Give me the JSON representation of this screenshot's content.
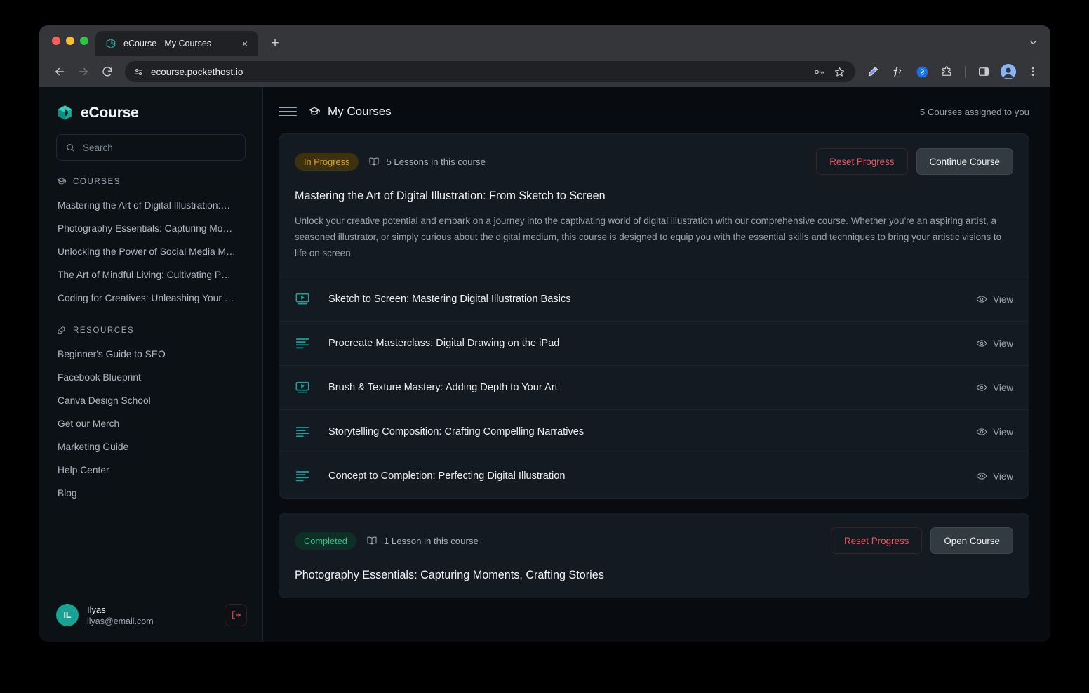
{
  "browser": {
    "tab": {
      "title": "eCourse - My Courses",
      "favicon": "ecourse-cube-icon"
    },
    "new_tab_label": "+",
    "close_label": "×",
    "tabstrip_menu_icon": "chevron-down-icon",
    "back_icon": "arrow-left-icon",
    "forward_icon": "arrow-right-icon",
    "reload_icon": "reload-icon",
    "site_info_icon": "site-settings-icon",
    "url": "ecourse.pockethost.io",
    "omnibox_icons": [
      "password-key-icon",
      "bookmark-star-icon"
    ],
    "toolbar_icons": [
      "highlighter-pen-icon",
      "math-solver-icon",
      "shazam-icon",
      "extensions-icon",
      "side-panel-icon",
      "profile-avatar-icon",
      "browser-menu-icon"
    ]
  },
  "sidebar": {
    "brand": {
      "name": "eCourse",
      "logo": "ecourse-cube-logo"
    },
    "search": {
      "placeholder": "Search",
      "value": "",
      "icon": "search-icon"
    },
    "courses_group": {
      "label": "COURSES",
      "icon": "graduation-cap-icon",
      "items": [
        {
          "label": "Mastering the Art of Digital Illustration:…"
        },
        {
          "label": "Photography Essentials: Capturing Mo…"
        },
        {
          "label": "Unlocking the Power of Social Media M…"
        },
        {
          "label": "The Art of Mindful Living: Cultivating P…"
        },
        {
          "label": "Coding for Creatives: Unleashing Your …"
        }
      ]
    },
    "resources_group": {
      "label": "RESOURCES",
      "icon": "link-icon",
      "items": [
        {
          "label": "Beginner's Guide to SEO"
        },
        {
          "label": "Facebook Blueprint"
        },
        {
          "label": "Canva Design School"
        },
        {
          "label": "Get our Merch"
        },
        {
          "label": "Marketing Guide"
        },
        {
          "label": "Help Center"
        },
        {
          "label": "Blog"
        }
      ]
    },
    "user": {
      "initials": "IL",
      "name": "Ilyas",
      "email": "ilyas@email.com",
      "logout_icon": "logout-icon"
    }
  },
  "header": {
    "menu_icon": "hamburger-menu-icon",
    "title_icon": "graduation-cap-icon",
    "title": "My Courses",
    "assigned_text": "5 Courses assigned to you"
  },
  "courses": [
    {
      "status": "In Progress",
      "status_kind": "inprogress",
      "lessons_count_text": "5 Lessons in this course",
      "book_icon": "open-book-icon",
      "reset_label": "Reset Progress",
      "primary_label": "Continue Course",
      "title": "Mastering the Art of Digital Illustration: From Sketch to Screen",
      "description": "Unlock your creative potential and embark on a journey into the captivating world of digital illustration with our comprehensive course. Whether you're an aspiring artist, a seasoned illustrator, or simply curious about the digital medium, this course is designed to equip you with the essential skills and techniques to bring your artistic visions to life on screen.",
      "lessons": [
        {
          "icon": "video-lesson-icon",
          "title": "Sketch to Screen: Mastering Digital Illustration Basics",
          "action": "View",
          "action_icon": "eye-icon"
        },
        {
          "icon": "text-lesson-icon",
          "title": "Procreate Masterclass: Digital Drawing on the iPad",
          "action": "View",
          "action_icon": "eye-icon"
        },
        {
          "icon": "video-lesson-icon",
          "title": "Brush & Texture Mastery: Adding Depth to Your Art",
          "action": "View",
          "action_icon": "eye-icon"
        },
        {
          "icon": "text-lesson-icon",
          "title": "Storytelling Composition: Crafting Compelling Narratives",
          "action": "View",
          "action_icon": "eye-icon"
        },
        {
          "icon": "text-lesson-icon",
          "title": "Concept to Completion: Perfecting Digital Illustration",
          "action": "View",
          "action_icon": "eye-icon"
        }
      ]
    },
    {
      "status": "Completed",
      "status_kind": "completed",
      "lessons_count_text": "1 Lesson in this course",
      "book_icon": "open-book-icon",
      "reset_label": "Reset Progress",
      "primary_label": "Open Course",
      "title": "Photography Essentials: Capturing Moments, Crafting Stories",
      "description": "",
      "lessons": []
    }
  ],
  "colors": {
    "accent_teal": "#16a394",
    "lesson_icon_teal": "#17a2a2",
    "danger_red": "#f0555f",
    "badge_inprogress_text": "#e3a81a",
    "badge_completed_text": "#2bc48a",
    "page_bg": "#080c10",
    "card_bg": "#131a21",
    "sidebar_bg": "#0c1116"
  }
}
